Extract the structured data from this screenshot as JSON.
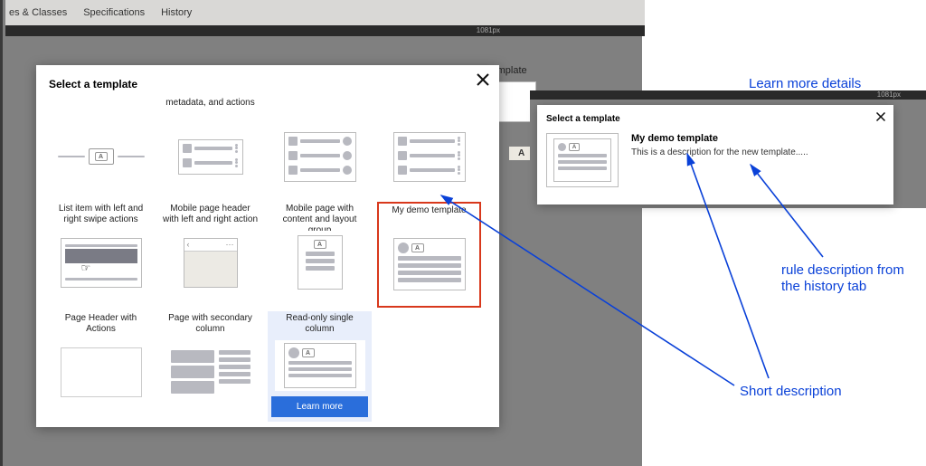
{
  "tabs": {
    "t1": "es & Classes",
    "t2": "Specifications",
    "t3": "History"
  },
  "ruler": {
    "px1": "1081px",
    "px2": "1081px"
  },
  "bgLeft": {
    "template_label": "Template",
    "a_label": "A"
  },
  "modal1": {
    "title": "Select a template",
    "cells": [
      {
        "label": ""
      },
      {
        "label": "metadata, and actions"
      },
      {
        "label": ""
      },
      {
        "label": ""
      },
      {
        "label": "List item with left and right swipe actions"
      },
      {
        "label": "Mobile page header with left and right action"
      },
      {
        "label": "Mobile page with content and layout group"
      },
      {
        "label": "My demo template"
      },
      {
        "label": "Page Header with Actions"
      },
      {
        "label": "Page with secondary column"
      },
      {
        "label": "Read-only single column",
        "learn": "Learn more"
      }
    ]
  },
  "modal2": {
    "title": "Select a template",
    "name": "My demo template",
    "desc": "This is a description for the new template....."
  },
  "annotations": {
    "learn_more": "Learn more details",
    "short_desc": "Short description",
    "rule_desc": "rule description from\nthe history tab"
  }
}
